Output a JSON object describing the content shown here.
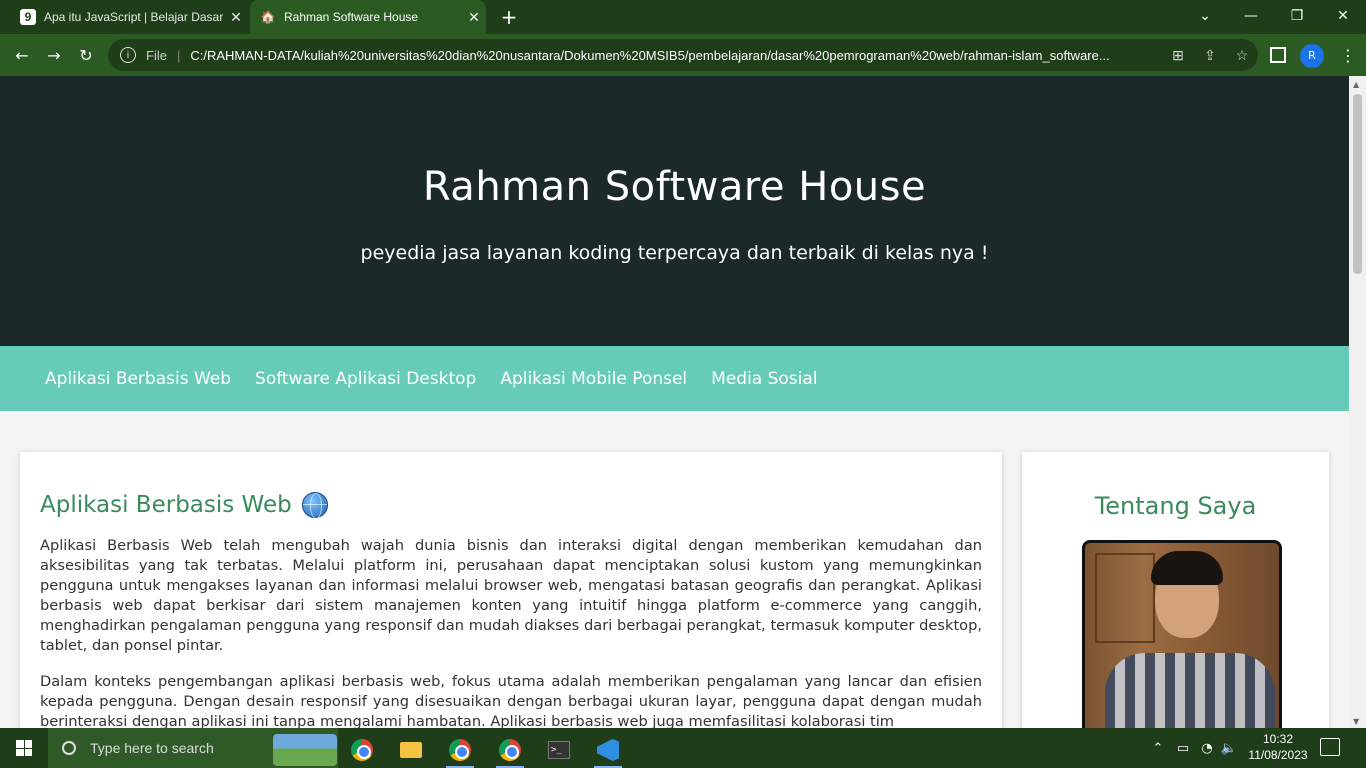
{
  "browser": {
    "tabs": [
      {
        "label": "Apa itu JavaScript | Belajar Dasar",
        "favicon": "9"
      },
      {
        "label": "Rahman Software House",
        "favicon": "house-icon"
      }
    ],
    "address": {
      "scheme_label": "File",
      "url": "C:/RAHMAN-DATA/kuliah%20universitas%20dian%20nusantara/Dokumen%20MSIB5/pembelajaran/dasar%20pemrograman%20web/rahman-islam_software..."
    },
    "profile_initial": "R"
  },
  "site": {
    "title": "Rahman Software House",
    "tagline": "peyedia jasa layanan koding terpercaya dan terbaik di kelas nya !",
    "nav": [
      "Aplikasi Berbasis Web",
      "Software Aplikasi Desktop",
      "Aplikasi Mobile Ponsel",
      "Media Sosial"
    ],
    "article": {
      "heading": "Aplikasi Berbasis Web",
      "paragraphs": [
        "Aplikasi Berbasis Web telah mengubah wajah dunia bisnis dan interaksi digital dengan memberikan kemudahan dan aksesibilitas yang tak terbatas. Melalui platform ini, perusahaan dapat menciptakan solusi kustom yang memungkinkan pengguna untuk mengakses layanan dan informasi melalui browser web, mengatasi batasan geografis dan perangkat. Aplikasi berbasis web dapat berkisar dari sistem manajemen konten yang intuitif hingga platform e-commerce yang canggih, menghadirkan pengalaman pengguna yang responsif dan mudah diakses dari berbagai perangkat, termasuk komputer desktop, tablet, dan ponsel pintar.",
        "Dalam konteks pengembangan aplikasi berbasis web, fokus utama adalah memberikan pengalaman yang lancar dan efisien kepada pengguna. Dengan desain responsif yang disesuaikan dengan berbagai ukuran layar, pengguna dapat dengan mudah berinteraksi dengan aplikasi ini tanpa mengalami hambatan. Aplikasi berbasis web juga memfasilitasi kolaborasi tim"
      ]
    },
    "aside": {
      "heading": "Tentang Saya"
    },
    "colors": {
      "hero_bg": "#1b2a28",
      "nav_bg": "#66ccb8",
      "heading": "#3a8a5c"
    }
  },
  "taskbar": {
    "search_placeholder": "Type here to search",
    "time": "10:32",
    "date": "11/08/2023"
  }
}
